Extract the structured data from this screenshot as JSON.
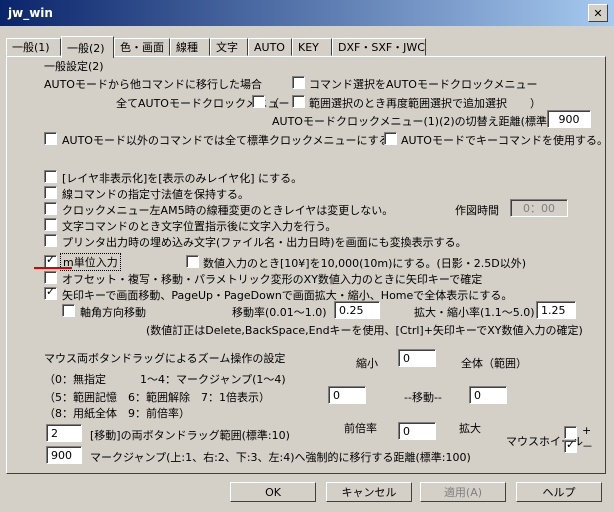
{
  "window": {
    "title": "jw_win",
    "close": "✕"
  },
  "tabs": [
    "一般(1)",
    "一般(2)",
    "色・画面",
    "線種",
    "文字",
    "AUTO",
    "KEY",
    "DXF・SXF・JWC"
  ],
  "section_title": "一般設定(2)",
  "auto": {
    "line1": "AUTOモードから他コマンドに移行した場合",
    "cb_select_auto": "コマンド選択をAUTOモードクロックメニュー",
    "all_auto_menu": "全てAUTOモードクロックメニュー",
    "paren_open": "（",
    "cb_range_add": "範囲選択のとき再度範囲選択で追加選択",
    "paren_close": "）",
    "switch_dist_label": "AUTOモードクロックメニュー(1)(2)の切替え距離(標準:100)",
    "switch_dist_value": "900",
    "cb_std_clock": "AUTOモード以外のコマンドでは全て標準クロックメニューにする。",
    "cb_key_cmd": "AUTOモードでキーコマンドを使用する。"
  },
  "opts": {
    "layer_hide": "[レイヤ非表示化]を[表示のみレイヤ化] にする。",
    "keep_dim": "線コマンドの指定寸法値を保持する。",
    "am5_layer": "クロックメニュー左AM5時の線種変更のときレイヤは変更しない。",
    "draw_time_label": "作図時間",
    "draw_time_value": "0：00",
    "text_pos": "文字コマンドのとき文字位置指示後に文字入力を行う。",
    "printer_embed": "プリンタ出力時の埋め込み文字(ファイル名・出力日時)を画面にも変換表示する。",
    "m_unit": "m単位入力",
    "num_input_10": "数値入力のとき[10¥]を10,000(10m)にする。(日影・2.5D以外)",
    "offset_arrow": "オフセット・複写・移動・パラメトリック変形のXY数値入力のときに矢印キーで確定",
    "arrow_screen": "矢印キーで画面移動、PageUp・PageDownで画面拡大・縮小、Homeで全体表示にする。",
    "axis_move": "軸角方向移動",
    "move_rate_label": "移動率(0.01～1.0)",
    "move_rate_value": "0.25",
    "zoom_rate_label": "拡大・縮小率(1.1～5.0)",
    "zoom_rate_value": "1.25",
    "note": "(数値訂正はDelete,BackSpace,Endキーを使用、[Ctrl]+矢印キーでXY数値入力の確定)"
  },
  "zoom": {
    "title": "マウス両ボタンドラッグによるズーム操作の設定",
    "legend1a": "（0：無指定",
    "legend1b": "1～4：マークジャンプ(1～4)",
    "legend2": "（5：範囲記憶　6：範囲解除　7：1倍表示）",
    "legend3": "（8：用紙全体　9：前倍率）",
    "shrink_label": "縮小",
    "shrink_value": "0",
    "whole_label": "全体（範囲）",
    "left_value": "0",
    "move_label": "--移動--",
    "right_value": "0",
    "prev_label": "前倍率",
    "prev_value": "0",
    "enlarge_label": "拡大",
    "range_value": "2",
    "range_label": "[移動]の両ボタンドラッグ範囲(標準:10)",
    "wheel_label": "マウスホイール",
    "wheel_plus": "+",
    "wheel_minus": "－",
    "jump_value": "900",
    "jump_label": "マークジャンプ(上:1、右:2、下:3、左:4)へ強制的に移行する距離(標準:100)"
  },
  "buttons": {
    "ok": "OK",
    "cancel": "キャンセル",
    "apply": "適用(A)",
    "help": "ヘルプ"
  }
}
